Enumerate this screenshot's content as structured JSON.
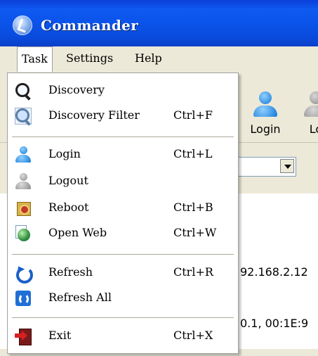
{
  "window": {
    "title": "Commander"
  },
  "menubar": {
    "task": "Task",
    "settings": "Settings",
    "help": "Help"
  },
  "toolbar": {
    "login_label": "Login",
    "logout_label_partial": "Lo"
  },
  "background": {
    "ip_text": "92.168.2.12",
    "mac_text": "0.1, 00:1E:9"
  },
  "task_menu": {
    "items": [
      {
        "label": "Discovery",
        "shortcut": "",
        "icon": "magnifier-icon"
      },
      {
        "label": "Discovery Filter",
        "shortcut": "Ctrl+F",
        "icon": "discovery-filter-icon"
      },
      {
        "label": "Login",
        "shortcut": "Ctrl+L",
        "icon": "login-user-icon"
      },
      {
        "label": "Logout",
        "shortcut": "",
        "icon": "logout-user-icon"
      },
      {
        "label": "Reboot",
        "shortcut": "Ctrl+B",
        "icon": "reboot-icon"
      },
      {
        "label": "Open Web",
        "shortcut": "Ctrl+W",
        "icon": "web-page-icon"
      },
      {
        "label": "Refresh",
        "shortcut": "Ctrl+R",
        "icon": "refresh-icon"
      },
      {
        "label": "Refresh All",
        "shortcut": "",
        "icon": "refresh-all-icon"
      },
      {
        "label": "Exit",
        "shortcut": "Ctrl+X",
        "icon": "exit-icon"
      }
    ]
  },
  "colors": {
    "titlebar": "#0b53ea",
    "menu_bg": "#ffffff",
    "chrome": "#ece9d8"
  }
}
